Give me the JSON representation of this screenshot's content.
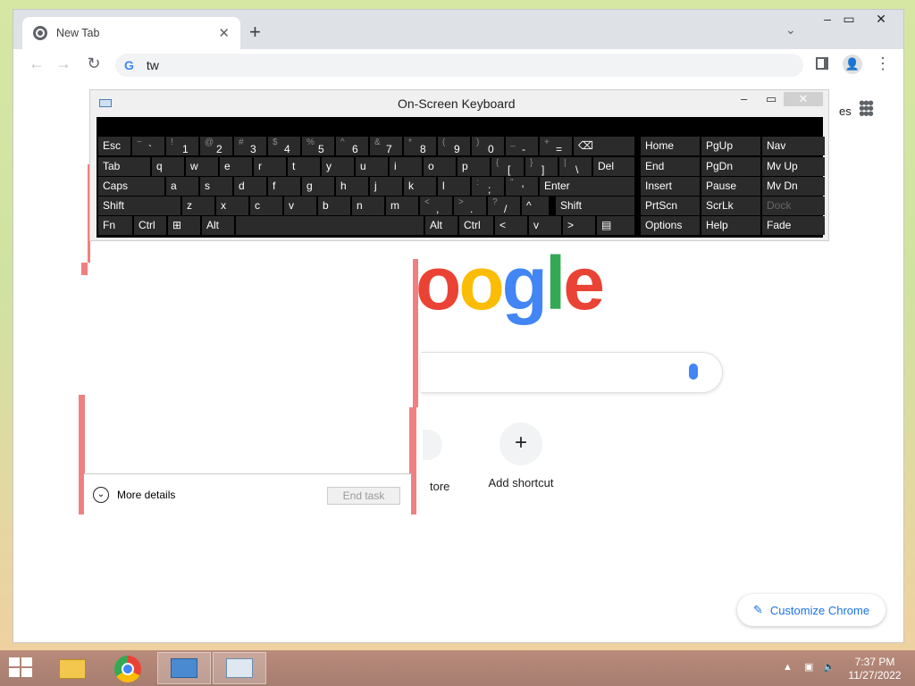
{
  "browser": {
    "tab_title": "New Tab",
    "tab_close": "✕",
    "new_tab": "+",
    "tab_search": "⌄",
    "window_controls": [
      "–",
      "▭",
      "✕"
    ],
    "omnibox_text": "tw",
    "omnibox_icon": "G",
    "nav": {
      "back": "←",
      "forward": "→",
      "reload": "↻"
    },
    "profile_icon": "👤",
    "menu_icon": "⋮"
  },
  "newtab": {
    "images_fragment": "es",
    "logo_fragment": [
      "o",
      "g",
      "l",
      "e"
    ],
    "logo_colors": [
      "#ea4335",
      "#fbbc05",
      "#4285f4",
      "#34a853",
      "#ea4335"
    ],
    "shortcut_fragment": "tore",
    "add_shortcut_label": "Add shortcut",
    "add_shortcut_icon": "+",
    "customize_label": "Customize Chrome",
    "customize_icon": "✎"
  },
  "task_manager": {
    "more_details": "More details",
    "end_task": "End task"
  },
  "osk": {
    "title": "On-Screen Keyboard",
    "controls": [
      "–",
      "▭",
      "✕"
    ],
    "rows": [
      [
        [
          "Esc"
        ],
        [
          "~",
          "`"
        ],
        [
          "!",
          "1"
        ],
        [
          "@",
          "2"
        ],
        [
          "#",
          "3"
        ],
        [
          "$",
          "4"
        ],
        [
          "%",
          "5"
        ],
        [
          "^",
          "6"
        ],
        [
          "&",
          "7"
        ],
        [
          "*",
          "8"
        ],
        [
          "(",
          "9"
        ],
        [
          ")",
          "0"
        ],
        [
          "_",
          "-"
        ],
        [
          "+",
          "="
        ],
        [
          "⌫"
        ],
        [
          "Home"
        ],
        [
          "PgUp"
        ],
        [
          "Nav"
        ]
      ],
      [
        [
          "Tab"
        ],
        [
          "q"
        ],
        [
          "w"
        ],
        [
          "e"
        ],
        [
          "r"
        ],
        [
          "t"
        ],
        [
          "y"
        ],
        [
          "u"
        ],
        [
          "i"
        ],
        [
          "o"
        ],
        [
          "p"
        ],
        [
          "{",
          "["
        ],
        [
          "}",
          "]"
        ],
        [
          "|",
          "\\"
        ],
        [
          "Del"
        ],
        [
          "End"
        ],
        [
          "PgDn"
        ],
        [
          "Mv Up"
        ]
      ],
      [
        [
          "Caps"
        ],
        [
          "a"
        ],
        [
          "s"
        ],
        [
          "d"
        ],
        [
          "f"
        ],
        [
          "g"
        ],
        [
          "h"
        ],
        [
          "j"
        ],
        [
          "k"
        ],
        [
          "l"
        ],
        [
          ":",
          ";"
        ],
        [
          "\"",
          "'"
        ],
        [
          "Enter"
        ],
        [
          "Insert"
        ],
        [
          "Pause"
        ],
        [
          "Mv Dn"
        ]
      ],
      [
        [
          "Shift"
        ],
        [
          "z"
        ],
        [
          "x"
        ],
        [
          "c"
        ],
        [
          "v"
        ],
        [
          "b"
        ],
        [
          "n"
        ],
        [
          "m"
        ],
        [
          "<",
          ","
        ],
        [
          ">",
          "."
        ],
        [
          "?",
          "/"
        ],
        [
          "^"
        ],
        [
          "Shift"
        ],
        [
          "PrtScn"
        ],
        [
          "ScrLk"
        ],
        [
          "Dock"
        ]
      ],
      [
        [
          "Fn"
        ],
        [
          "Ctrl"
        ],
        [
          "⊞"
        ],
        [
          "Alt"
        ],
        [
          ""
        ],
        [
          "Alt"
        ],
        [
          "Ctrl"
        ],
        [
          "<"
        ],
        [
          "v"
        ],
        [
          ">"
        ],
        [
          "▤"
        ],
        [
          "Options"
        ],
        [
          "Help"
        ],
        [
          "Fade"
        ]
      ]
    ]
  },
  "taskbar": {
    "time": "7:37 PM",
    "date": "11/27/2022",
    "apps": [
      "file-explorer-icon",
      "chrome-icon",
      "osk-app-icon",
      "task-manager-icon"
    ],
    "tray": "▲"
  }
}
